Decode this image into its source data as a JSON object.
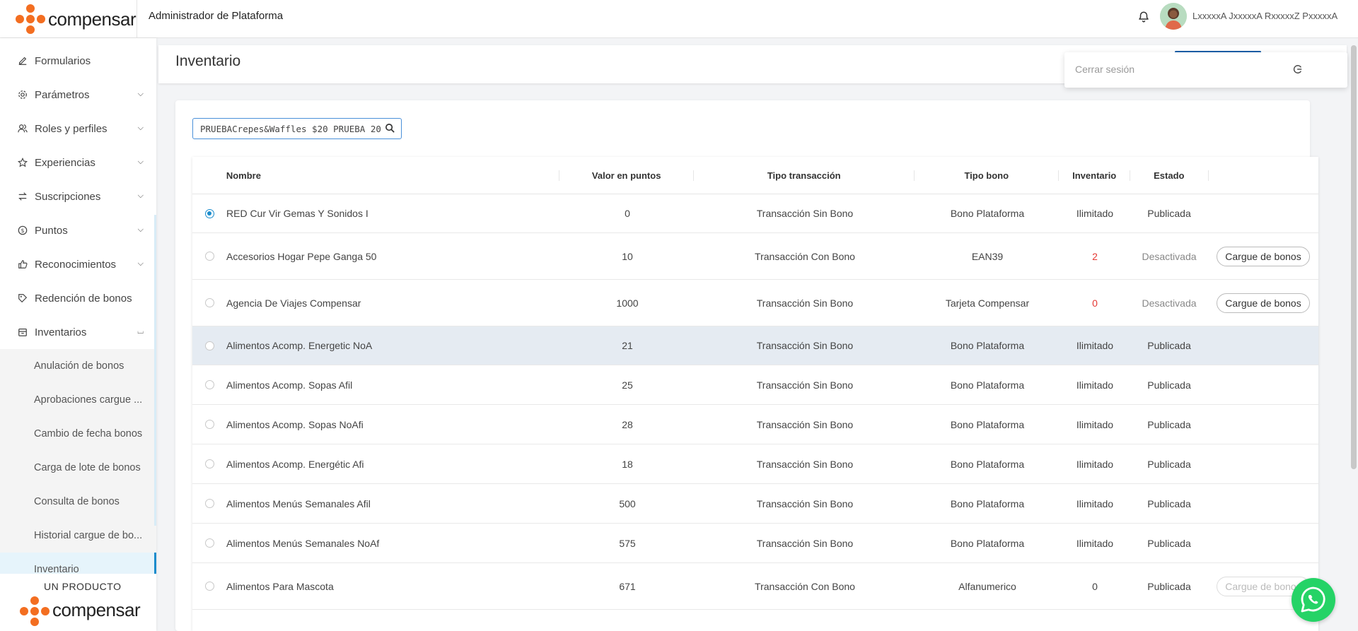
{
  "brand": {
    "name": "compensar",
    "accent": "#f36e21"
  },
  "header": {
    "app_title": "Administrador de Plataforma",
    "user_name": "LxxxxxA JxxxxxA RxxxxxZ PxxxxxA"
  },
  "logout_menu": {
    "label": "Cerrar sesión"
  },
  "sidebar": {
    "items": [
      {
        "label": "Formularios",
        "icon": "edit-icon"
      },
      {
        "label": "Parámetros",
        "icon": "gear-icon"
      },
      {
        "label": "Roles y perfiles",
        "icon": "users-icon"
      },
      {
        "label": "Experiencias",
        "icon": "star-icon"
      },
      {
        "label": "Suscripciones",
        "icon": "swap-icon"
      },
      {
        "label": "Puntos",
        "icon": "coin-icon"
      },
      {
        "label": "Reconocimientos",
        "icon": "thumbs-up-icon"
      },
      {
        "label": "Redención de bonos",
        "icon": "tag-icon"
      },
      {
        "label": "Inventarios",
        "icon": "inventory-icon"
      }
    ],
    "sub_items": [
      "Anulación de bonos",
      "Aprobaciones cargue ...",
      "Cambio de fecha bonos",
      "Carga de lote de bonos",
      "Consulta de bonos",
      "Historial cargue de bo...",
      "Inventario"
    ],
    "footer_caption": "UN PRODUCTO",
    "footer_brand": "compensar"
  },
  "page": {
    "title": "Inventario"
  },
  "search": {
    "value": "20 PRUEBACrepes&Waffles $20 PRUEBA"
  },
  "table": {
    "headers": {
      "name": "Nombre",
      "points": "Valor en puntos",
      "transaction": "Tipo transacción",
      "bonus_type": "Tipo bono",
      "inventory": "Inventario",
      "status": "Estado"
    },
    "rows": [
      {
        "name": "RED Cur Vir Gemas Y Sonidos I",
        "points": "0",
        "transaction": "Transacción Sin Bono",
        "bonus_type": "Bono Plataforma",
        "inventory": "Ilimitado",
        "status": "Publicada",
        "action": ""
      },
      {
        "name": "Accesorios Hogar Pepe Ganga 50",
        "points": "10",
        "transaction": "Transacción Con Bono",
        "bonus_type": "EAN39",
        "inventory": "2",
        "status": "Desactivada",
        "action": "Cargue de bonos"
      },
      {
        "name": "Agencia De Viajes Compensar",
        "points": "1000",
        "transaction": "Transacción Sin Bono",
        "bonus_type": "Tarjeta Compensar",
        "inventory": "0",
        "status": "Desactivada",
        "action": "Cargue de bonos"
      },
      {
        "name": "Alimentos Acomp. Energetic NoA",
        "points": "21",
        "transaction": "Transacción Sin Bono",
        "bonus_type": "Bono Plataforma",
        "inventory": "Ilimitado",
        "status": "Publicada",
        "action": ""
      },
      {
        "name": "Alimentos Acomp. Sopas Afil",
        "points": "25",
        "transaction": "Transacción Sin Bono",
        "bonus_type": "Bono Plataforma",
        "inventory": "Ilimitado",
        "status": "Publicada",
        "action": ""
      },
      {
        "name": "Alimentos Acomp. Sopas NoAfi",
        "points": "28",
        "transaction": "Transacción Sin Bono",
        "bonus_type": "Bono Plataforma",
        "inventory": "Ilimitado",
        "status": "Publicada",
        "action": ""
      },
      {
        "name": "Alimentos Acomp. Energétic Afi",
        "points": "18",
        "transaction": "Transacción Sin Bono",
        "bonus_type": "Bono Plataforma",
        "inventory": "Ilimitado",
        "status": "Publicada",
        "action": ""
      },
      {
        "name": "Alimentos Menús Semanales Afil",
        "points": "500",
        "transaction": "Transacción Sin Bono",
        "bonus_type": "Bono Plataforma",
        "inventory": "Ilimitado",
        "status": "Publicada",
        "action": ""
      },
      {
        "name": "Alimentos Menús Semanales NoAf",
        "points": "575",
        "transaction": "Transacción Sin Bono",
        "bonus_type": "Bono Plataforma",
        "inventory": "Ilimitado",
        "status": "Publicada",
        "action": ""
      },
      {
        "name": "Alimentos Para Mascota",
        "points": "671",
        "transaction": "Transacción Con Bono",
        "bonus_type": "Alfanumerico",
        "inventory": "0",
        "status": "Publicada",
        "action": "Cargue de bonos"
      }
    ]
  },
  "colors": {
    "primary": "#1b8ccc",
    "alert": "#e53935",
    "whatsapp": "#25d366"
  }
}
